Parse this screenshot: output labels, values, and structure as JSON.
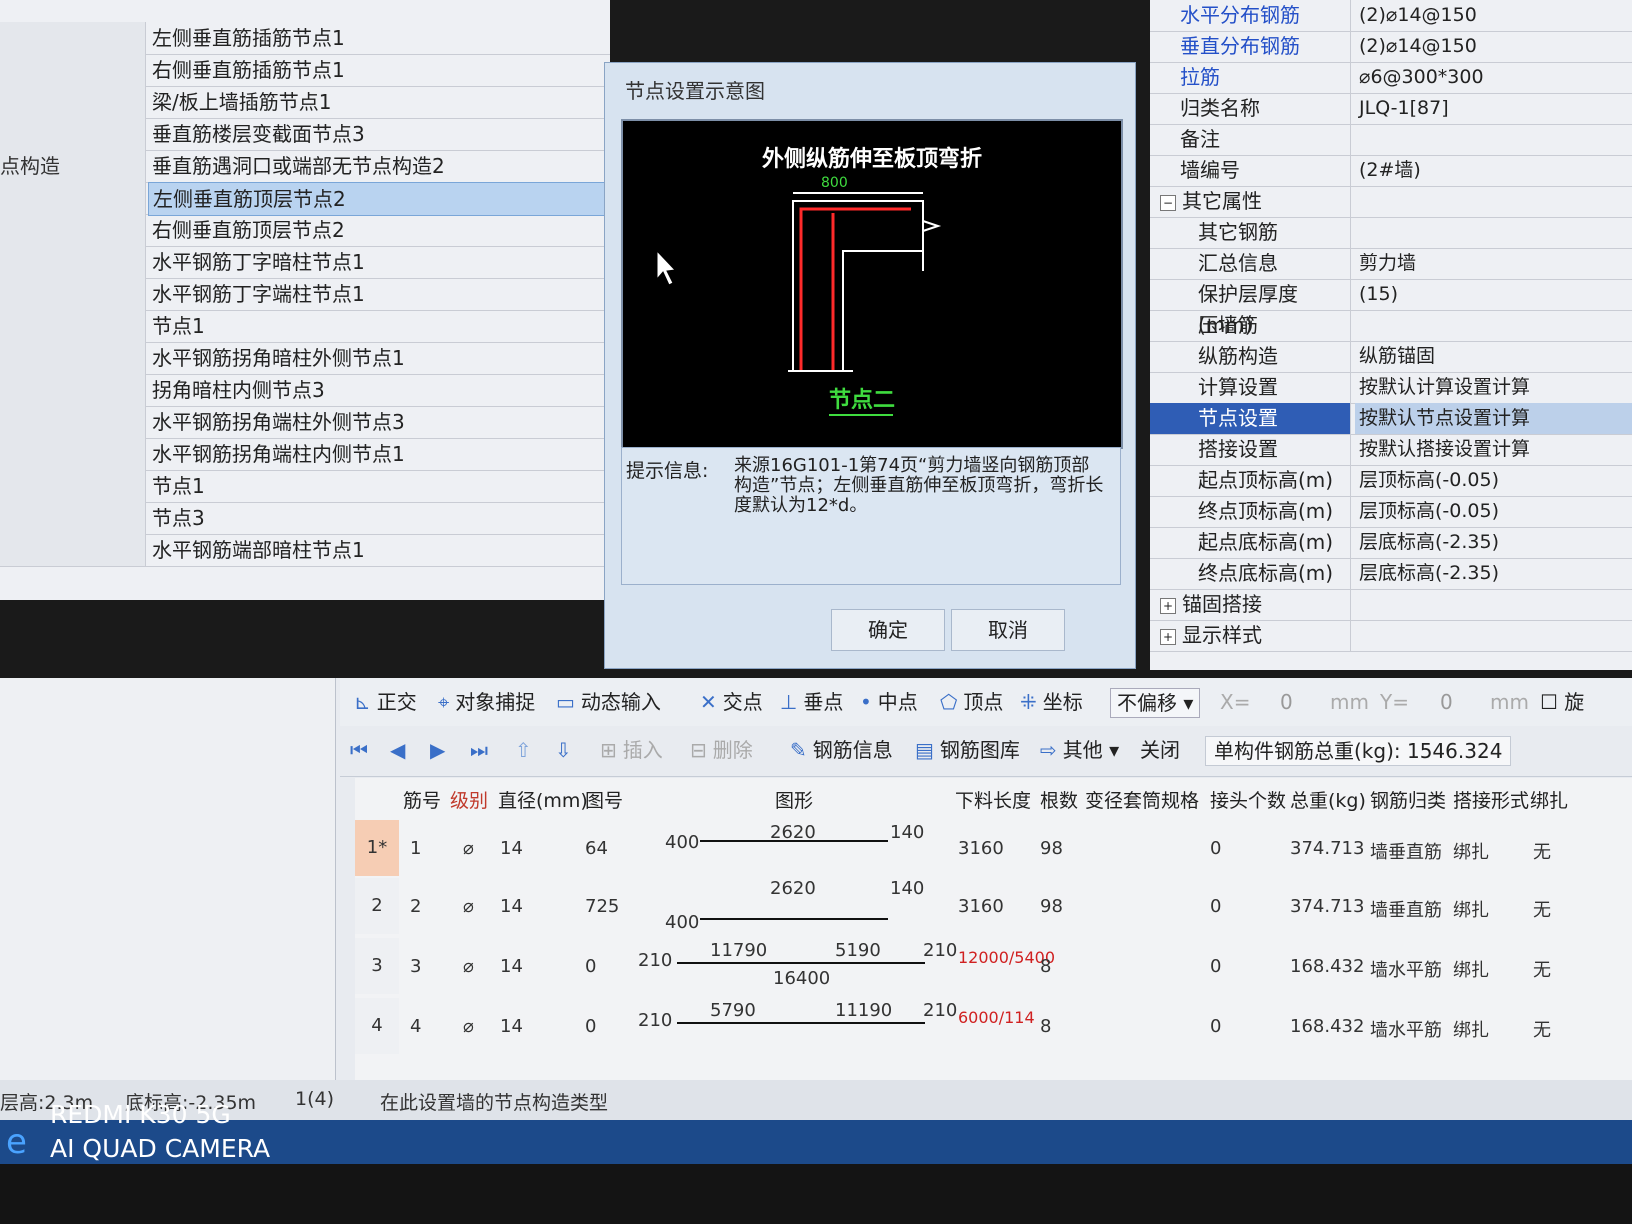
{
  "node_list": {
    "rows": [
      {
        "label": "",
        "value": "左侧垂直筋插筋节点1"
      },
      {
        "label": "",
        "value": "右侧垂直筋插筋节点1"
      },
      {
        "label": "",
        "value": "梁/板上墙插筋节点1"
      },
      {
        "label": "",
        "value": "垂直筋楼层变截面节点3"
      },
      {
        "label": "点构造",
        "value": "垂直筋遇洞口或端部无节点构造2"
      },
      {
        "label": "",
        "value": "左侧垂直筋顶层节点2"
      },
      {
        "label": "",
        "value": "右侧垂直筋顶层节点2"
      },
      {
        "label": "",
        "value": "水平钢筋丁字暗柱节点1"
      },
      {
        "label": "",
        "value": "水平钢筋丁字端柱节点1"
      },
      {
        "label": "",
        "value": "节点1"
      },
      {
        "label": "",
        "value": "水平钢筋拐角暗柱外侧节点1"
      },
      {
        "label": "",
        "value": "拐角暗柱内侧节点3"
      },
      {
        "label": "",
        "value": "水平钢筋拐角端柱外侧节点3"
      },
      {
        "label": "",
        "value": "水平钢筋拐角端柱内侧节点1"
      },
      {
        "label": "",
        "value": "节点1"
      },
      {
        "label": "",
        "value": "节点3"
      },
      {
        "label": "",
        "value": "水平钢筋端部暗柱节点1"
      }
    ]
  },
  "dialog": {
    "title": "节点设置示意图",
    "preview_title": "外侧纵筋伸至板顶弯折",
    "dim_label": "800",
    "node_label": "节点二",
    "hint_label": "提示信息:",
    "hint_text": "来源16G101-1第74页“剪力墙竖向钢筋顶部构造”节点；左侧垂直筋伸至板顶弯折，弯折长度默认为12*d。",
    "ok_label": "确定",
    "cancel_label": "取消"
  },
  "props": {
    "rows": [
      {
        "name": "水平分布钢筋",
        "value": "(2)⌀14@150",
        "blue": true,
        "indent": 0,
        "toggle": ""
      },
      {
        "name": "垂直分布钢筋",
        "value": "(2)⌀14@150",
        "blue": true,
        "indent": 0,
        "toggle": ""
      },
      {
        "name": "拉筋",
        "value": "⌀6@300*300",
        "blue": true,
        "indent": 0,
        "toggle": ""
      },
      {
        "name": "归类名称",
        "value": "JLQ-1[87]",
        "blue": false,
        "indent": 0,
        "toggle": ""
      },
      {
        "name": "备注",
        "value": "",
        "blue": false,
        "indent": 0,
        "toggle": ""
      },
      {
        "name": "墙编号",
        "value": "(2#墙)",
        "blue": false,
        "indent": 0,
        "toggle": ""
      },
      {
        "name": "其它属性",
        "value": "",
        "blue": false,
        "indent": 0,
        "toggle": "−"
      },
      {
        "name": "其它钢筋",
        "value": "",
        "blue": false,
        "indent": 1,
        "toggle": ""
      },
      {
        "name": "汇总信息",
        "value": "剪力墙",
        "blue": false,
        "indent": 1,
        "toggle": ""
      },
      {
        "name": "保护层厚度(mm)",
        "value": "(15)",
        "blue": false,
        "indent": 1,
        "toggle": ""
      },
      {
        "name": "压墙筋",
        "value": "",
        "blue": false,
        "indent": 1,
        "toggle": ""
      },
      {
        "name": "纵筋构造",
        "value": "纵筋锚固",
        "blue": false,
        "indent": 1,
        "toggle": ""
      },
      {
        "name": "计算设置",
        "value": "按默认计算设置计算",
        "blue": false,
        "indent": 1,
        "toggle": ""
      },
      {
        "name": "节点设置",
        "value": "按默认节点设置计算",
        "blue": false,
        "indent": 1,
        "toggle": "",
        "selected": true
      },
      {
        "name": "搭接设置",
        "value": "按默认搭接设置计算",
        "blue": false,
        "indent": 1,
        "toggle": ""
      },
      {
        "name": "起点顶标高(m)",
        "value": "层顶标高(-0.05)",
        "blue": false,
        "indent": 1,
        "toggle": ""
      },
      {
        "name": "终点顶标高(m)",
        "value": "层顶标高(-0.05)",
        "blue": false,
        "indent": 1,
        "toggle": ""
      },
      {
        "name": "起点底标高(m)",
        "value": "层底标高(-2.35)",
        "blue": false,
        "indent": 1,
        "toggle": ""
      },
      {
        "name": "终点底标高(m)",
        "value": "层底标高(-2.35)",
        "blue": false,
        "indent": 1,
        "toggle": ""
      },
      {
        "name": "锚固搭接",
        "value": "",
        "blue": false,
        "indent": 0,
        "toggle": "+"
      },
      {
        "name": "显示样式",
        "value": "",
        "blue": false,
        "indent": 0,
        "toggle": "+"
      }
    ]
  },
  "toolbar1": {
    "items": [
      "正交",
      "对象捕捉",
      "动态输入",
      "交点",
      "垂点",
      "中点",
      "顶点",
      "坐标"
    ],
    "offset_mode": "不偏移",
    "x_label": "X=",
    "x_value": "0",
    "x_unit": "mm",
    "y_label": "Y=",
    "y_value": "0",
    "y_unit": "mm",
    "rotate_label": "旋"
  },
  "toolbar2": {
    "insert_label": "插入",
    "delete_label": "删除",
    "rebar_info_label": "钢筋信息",
    "rebar_lib_label": "钢筋图库",
    "other_label": "其他",
    "close_label": "关闭",
    "total_label": "单构件钢筋总重(kg):",
    "total_value": "1546.324"
  },
  "grid": {
    "headers": [
      "筋号",
      "级别",
      "直径(mm)",
      "图号",
      "图形",
      "下料长度",
      "根数",
      "变径套筒规格",
      "接头个数",
      "总重(kg)",
      "钢筋归类",
      "搭接形式",
      "绑扎"
    ],
    "rows": [
      {
        "no": "1*",
        "id": "1",
        "grade": "⌀",
        "dia": "14",
        "fig": "64",
        "s1": "400",
        "s2": "2620",
        "s3": "140",
        "s4": "",
        "s5": "",
        "length": "3160",
        "count": "98",
        "joints": "0",
        "weight": "374.713",
        "type": "墙垂直筋",
        "lap": "绑扎",
        "extra": "无",
        "red": false
      },
      {
        "no": "2",
        "id": "2",
        "grade": "⌀",
        "dia": "14",
        "fig": "725",
        "s1": "400",
        "s2": "2620",
        "s3": "140",
        "s4": "",
        "s5": "",
        "length": "3160",
        "count": "98",
        "joints": "0",
        "weight": "374.713",
        "type": "墙垂直筋",
        "lap": "绑扎",
        "extra": "无",
        "red": false
      },
      {
        "no": "3",
        "id": "3",
        "grade": "⌀",
        "dia": "14",
        "fig": "0",
        "s1": "210",
        "s2": "11790",
        "s3": "5190",
        "s4": "210",
        "s5": "16400",
        "length": "12000/5400",
        "count": "8",
        "joints": "0",
        "weight": "168.432",
        "type": "墙水平筋",
        "lap": "绑扎",
        "extra": "无",
        "red": true
      },
      {
        "no": "4",
        "id": "4",
        "grade": "⌀",
        "dia": "14",
        "fig": "0",
        "s1": "210",
        "s2": "5790",
        "s3": "11190",
        "s4": "210",
        "s5": "",
        "length": "6000/114",
        "count": "8",
        "joints": "0",
        "weight": "168.432",
        "type": "墙水平筋",
        "lap": "绑扎",
        "extra": "无",
        "red": true
      }
    ]
  },
  "status": {
    "floor_height": "层高:2.3m",
    "base_elev": "底标高:-2.35m",
    "count": "1(4)",
    "message": "在此设置墙的节点构造类型"
  },
  "watermark": {
    "line1": "REDMI K30 5G",
    "line2": "AI QUAD CAMERA"
  }
}
